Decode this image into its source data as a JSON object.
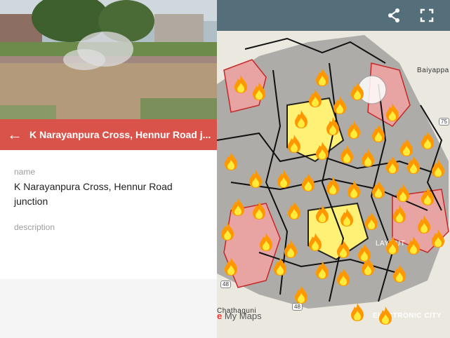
{
  "place": {
    "title": "K Narayanpura Cross, Hennur Road j...",
    "back_label": "←",
    "fields": [
      {
        "label": "name",
        "value": "K Narayanpura Cross, Hennur Road junction"
      },
      {
        "label": "description",
        "value": ""
      }
    ]
  },
  "map": {
    "share_icon": "share-icon",
    "fullscreen_icon": "fullscreen-icon",
    "google_prefix": "e",
    "google_suffix": " My Maps",
    "labels": {
      "baiyappa": "Baiyappa",
      "electronic_city": "ELECTRONIC CITY",
      "layout": "LAYOUT",
      "chathaguni": "Chathaguni",
      "road48a": "48",
      "road48b": "48",
      "road75": "75"
    },
    "colors": {
      "header": "#546e7a",
      "titlebar": "#d9534a",
      "fire": "#ff9800",
      "polygon_red": "#e57373"
    }
  }
}
